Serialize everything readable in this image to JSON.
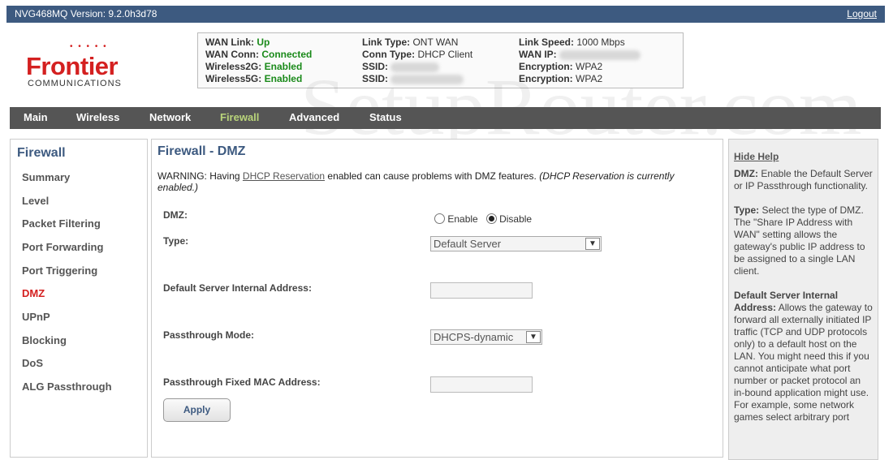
{
  "header": {
    "version": "NVG468MQ Version: 9.2.0h3d78",
    "logout": "Logout"
  },
  "logo": {
    "dots": "• • • • •",
    "brand": "Frontier",
    "sub": "COMMUNICATIONS"
  },
  "status": {
    "wan_link_label": "WAN Link:",
    "wan_link_value": "Up",
    "wan_conn_label": "WAN Conn:",
    "wan_conn_value": "Connected",
    "wireless2g_label": "Wireless2G:",
    "wireless2g_value": "Enabled",
    "wireless5g_label": "Wireless5G:",
    "wireless5g_value": "Enabled",
    "link_type_label": "Link Type:",
    "link_type_value": "ONT WAN",
    "conn_type_label": "Conn Type:",
    "conn_type_value": "DHCP Client",
    "ssid_label_1": "SSID:",
    "ssid_label_2": "SSID:",
    "link_speed_label": "Link Speed:",
    "link_speed_value": "1000 Mbps",
    "wan_ip_label": "WAN IP:",
    "encryption_label_1": "Encryption:",
    "encryption_value_1": "WPA2",
    "encryption_label_2": "Encryption:",
    "encryption_value_2": "WPA2"
  },
  "watermark": "SetupRouter.com",
  "nav": {
    "tabs": [
      "Main",
      "Wireless",
      "Network",
      "Firewall",
      "Advanced",
      "Status"
    ],
    "active": "Firewall"
  },
  "sidebar": {
    "title": "Firewall",
    "items": [
      "Summary",
      "Level",
      "Packet Filtering",
      "Port Forwarding",
      "Port Triggering",
      "DMZ",
      "UPnP",
      "Blocking",
      "DoS",
      "ALG Passthrough"
    ],
    "active": "DMZ"
  },
  "main": {
    "title": "Firewall - DMZ",
    "warning_prefix": "WARNING: Having ",
    "warning_link": "DHCP Reservation",
    "warning_suffix": " enabled can cause problems with DMZ features. ",
    "warning_italic": "(DHCP Reservation is currently enabled.)",
    "dmz_label": "DMZ:",
    "enable_label": "Enable",
    "disable_label": "Disable",
    "dmz_selected": "Disable",
    "type_label": "Type:",
    "type_value": "Default Server",
    "default_server_label": "Default Server Internal Address:",
    "default_server_value": "",
    "passthrough_mode_label": "Passthrough Mode:",
    "passthrough_mode_value": "DHCPS-dynamic",
    "passthrough_mac_label": "Passthrough Fixed MAC Address:",
    "passthrough_mac_value": "",
    "apply_label": "Apply"
  },
  "help": {
    "hide": "Hide Help",
    "dmz_term": "DMZ:",
    "dmz_text": " Enable the Default Server or IP Passthrough functionality.",
    "type_term": "Type:",
    "type_text": " Select the type of DMZ. The \"Share IP Address with WAN\" setting allows the gateway's public IP address to be assigned to a single LAN client.",
    "dsia_term": "Default Server Internal Address:",
    "dsia_text": " Allows the gateway to forward all externally initiated IP traffic (TCP and UDP protocols only) to a default host on the LAN. You might need this if you cannot anticipate what port number or packet protocol an in-bound application might use. For example, some network games select arbitrary port"
  },
  "colors": {
    "header_bg": "#3d5a80",
    "nav_bg": "#555555",
    "brand_red": "#d42020",
    "status_green": "#1a8a1a",
    "active_tab": "#b9d47a"
  }
}
